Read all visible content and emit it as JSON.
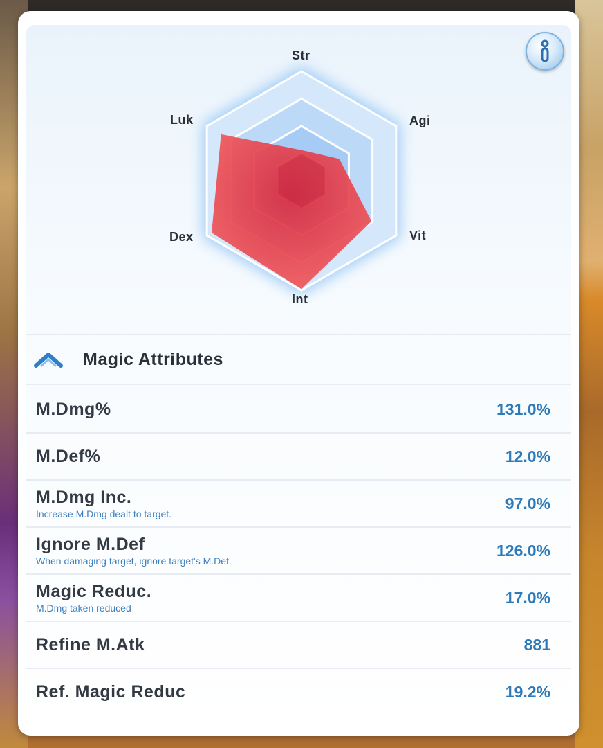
{
  "radar": {
    "title": "",
    "axes": [
      "Str",
      "Agi",
      "Vit",
      "Int",
      "Dex",
      "Luk"
    ],
    "levels": 4,
    "values": [
      0.28,
      0.4,
      0.74,
      0.99,
      0.95,
      0.85
    ],
    "colors": {
      "grid_fill": "#cfe3fa",
      "grid_stroke": "#ffffff",
      "glow": "#9ccbf7",
      "value_fill": "#f0585a",
      "value_center": "#d7293f"
    }
  },
  "header": {
    "info_icon": "info-icon",
    "section_icon": "chevron-up-icon",
    "section_title": "Magic Attributes"
  },
  "attributes": [
    {
      "name": "M.Dmg%",
      "desc": "",
      "value": "131.0%"
    },
    {
      "name": "M.Def%",
      "desc": "",
      "value": "12.0%"
    },
    {
      "name": "M.Dmg Inc.",
      "desc": "Increase M.Dmg dealt to target.",
      "value": "97.0%"
    },
    {
      "name": "Ignore M.Def",
      "desc": "When damaging target, ignore target's M.Def.",
      "value": "126.0%"
    },
    {
      "name": "Magic Reduc.",
      "desc": "M.Dmg taken reduced",
      "value": "17.0%"
    },
    {
      "name": "Refine M.Atk",
      "desc": "",
      "value": "881"
    },
    {
      "name": "Ref. Magic Reduc",
      "desc": "",
      "value": "19.2%"
    }
  ]
}
